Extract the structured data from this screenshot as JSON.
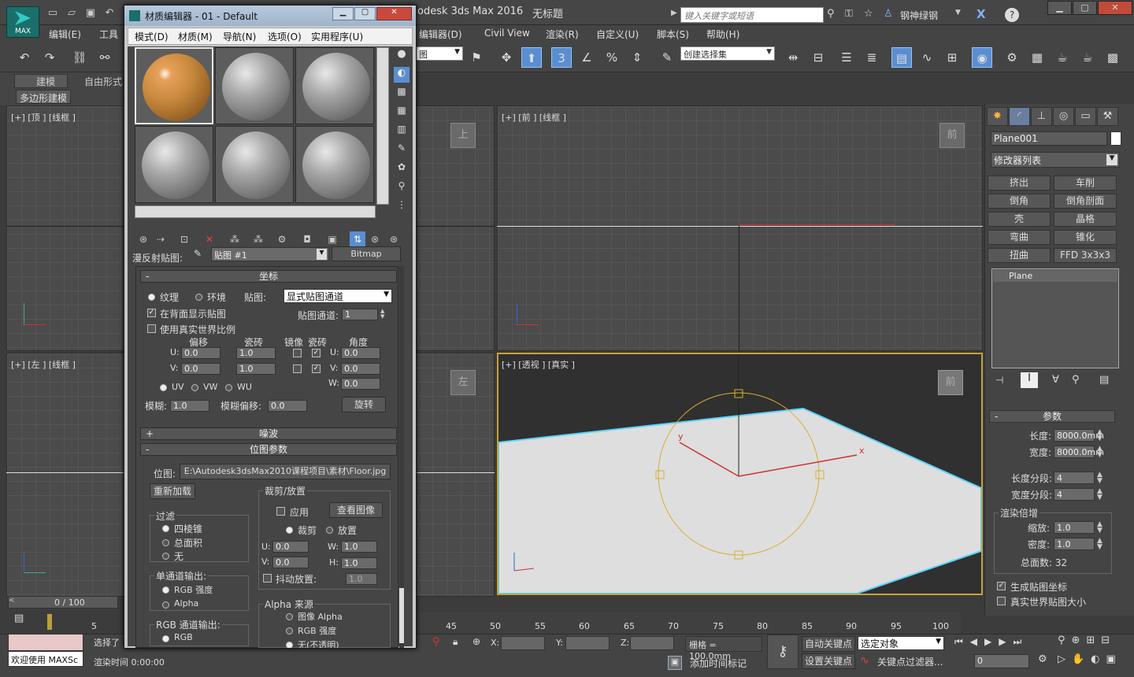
{
  "app": {
    "title": "Autodesk 3ds Max 2016",
    "title_visible": "odesk 3ds Max 2016",
    "document": "无标题",
    "logo_text": "MAX",
    "search_placeholder": "键入关键字或短语",
    "user": "钢神绿钢"
  },
  "menu": {
    "items": [
      "编辑(E)",
      "工具",
      "编辑器(D)",
      "Civil View",
      "渲染(R)",
      "自定义(U)",
      "脚本(S)",
      "帮助(H)"
    ]
  },
  "toolbar": {
    "layer_value": "图",
    "selection_set": "创建选择集"
  },
  "ribbon": {
    "tabs": [
      "建模",
      "自由形式"
    ],
    "panel": "多边形建模"
  },
  "viewports": {
    "top": "[+] [顶 ] [线框 ]",
    "front": "[+] [前 ] [线框 ]",
    "left": "[+] [左 ] [线框 ]",
    "persp": "[+] [透视 ] [真实 ]",
    "cube_top": "上",
    "cube_front": "前",
    "cube_left": "左",
    "cube_persp": "前"
  },
  "command_panel": {
    "object_name": "Plane001",
    "modifier_list": "修改器列表",
    "buttons": [
      "挤出",
      "车削",
      "倒角",
      "倒角剖面",
      "壳",
      "晶格",
      "弯曲",
      "锥化",
      "扭曲",
      "FFD 3x3x3"
    ],
    "stack_item": "Plane",
    "params_title": "参数",
    "length_label": "长度:",
    "length_value": "8000.0mm",
    "width_label": "宽度:",
    "width_value": "8000.0mm",
    "lseg_label": "长度分段:",
    "lseg_value": "4",
    "wseg_label": "宽度分段:",
    "wseg_value": "4",
    "render_group": "渲染倍增",
    "scale_label": "缩放:",
    "scale_value": "1.0",
    "density_label": "密度:",
    "density_value": "1.0",
    "total_faces": "总面数: 32",
    "gen_coords": "生成贴图坐标",
    "real_world": "真实世界贴图大小"
  },
  "material_editor": {
    "title": "材质编辑器 - 01 - Default",
    "menu": [
      "模式(D)",
      "材质(M)",
      "导航(N)",
      "选项(O)",
      "实用程序(U)"
    ],
    "diffuse_label": "漫反射贴图:",
    "map_name": "贴图 #1",
    "map_type": "Bitmap",
    "coords_title": "坐标",
    "texture_label": "纹理",
    "env_label": "环境",
    "map_label": "贴图:",
    "map_channel_dropdown": "显式贴图通道",
    "show_back": "在背面显示贴图",
    "map_channel_label": "贴图通道:",
    "map_channel_value": "1",
    "real_world_scale": "使用真实世界比例",
    "col_offset": "偏移",
    "col_tiling": "瓷砖",
    "col_mirror": "镜像",
    "col_tile": "瓷砖",
    "col_angle": "角度",
    "u_label": "U:",
    "v_label": "V:",
    "w_label": "W:",
    "u_offset": "0.0",
    "u_tiling": "1.0",
    "v_offset": "0.0",
    "v_tiling": "1.0",
    "u_angle": "0.0",
    "v_angle": "0.0",
    "w_angle": "0.0",
    "uv": "UV",
    "vw": "VW",
    "wu": "WU",
    "blur_label": "模糊:",
    "blur_value": "1.0",
    "blur_offset_label": "模糊偏移:",
    "blur_offset_value": "0.0",
    "rotate_btn": "旋转",
    "noise_title": "噪波",
    "bitmap_params_title": "位图参数",
    "bitmap_label": "位图:",
    "bitmap_path": "E:\\Autodesk3dsMax2010课程项目\\素材\\Floor.jpg",
    "reload_btn": "重新加载",
    "filter_group": "过滤",
    "filter_opts": [
      "四棱锥",
      "总面积",
      "无"
    ],
    "crop_group": "裁剪/放置",
    "apply_label": "应用",
    "view_image_btn": "查看图像",
    "crop_label": "裁剪",
    "place_label": "放置",
    "crop_u": "0.0",
    "crop_v": "0.0",
    "crop_w": "1.0",
    "crop_h": "1.0",
    "w_label2": "W:",
    "h_label": "H:",
    "jitter_label": "抖动放置:",
    "jitter_value": "1.0",
    "mono_group": "单通道输出:",
    "mono_opts": [
      "RGB 强度",
      "Alpha"
    ],
    "rgb_group": "RGB 通道输出:",
    "rgb_opt": "RGB",
    "alpha_group": "Alpha 来源",
    "alpha_opts": [
      "图像 Alpha",
      "RGB 强度",
      "无(不透明)"
    ],
    "plus": "+",
    "minus": "-"
  },
  "timeline": {
    "frame": "0 / 100",
    "ticks": [
      "5",
      "45",
      "50",
      "55",
      "60",
      "65",
      "70",
      "75",
      "80",
      "85",
      "90",
      "95",
      "100"
    ]
  },
  "status": {
    "welcome": "欢迎使用 MAXSc",
    "selected": "选择了",
    "render_time": "渲染时间 0:00:00",
    "x_label": "X:",
    "y_label": "Y:",
    "z_label": "Z:",
    "grid": "栅格 = 100.0mm",
    "add_time_tag": "添加时间标记",
    "auto_key": "自动关键点",
    "set_key": "设置关键点",
    "selected_obj": "选定对象",
    "key_filters": "关键点过滤器...",
    "frame_field": "0"
  }
}
